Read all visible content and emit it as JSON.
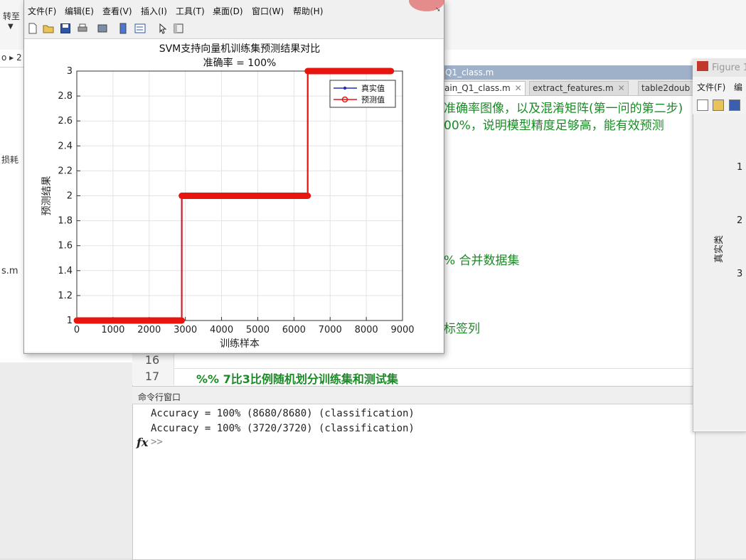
{
  "background": {
    "toolstrip_label": "转至",
    "address_text": "o ▸ 2",
    "left_snippets": [
      "损耗",
      "s.m"
    ],
    "editor": {
      "title": "Q1_class.m",
      "tabs": [
        {
          "label": "ain_Q1_class.m"
        },
        {
          "label": "extract_features.m"
        },
        {
          "label": "table2doub"
        }
      ],
      "code_lines": [
        "准确率图像，以及混淆矩阵(第一问的第二步)",
        "00%，说明模型精度足够高，能有效预测",
        "% 合并数据集",
        "标签列"
      ],
      "line_numbers": [
        "16",
        "17"
      ],
      "line_17_text": "%% 7比3比例随机划分训练集和测试集"
    },
    "command_window": {
      "title": "命令行窗口",
      "lines": [
        "Accuracy = 100% (8680/8680) (classification)",
        "Accuracy = 100% (3720/3720) (classification)"
      ],
      "fx": "fx",
      "prompt": ">>"
    },
    "right_figure": {
      "title": "Figure 1",
      "menu": [
        "文件(F)",
        "编"
      ],
      "ticks": [
        "1",
        "2",
        "3"
      ],
      "ylabel": "真实类"
    }
  },
  "figure": {
    "menu": [
      "文件(F)",
      "编辑(E)",
      "查看(V)",
      "插入(I)",
      "工具(T)",
      "桌面(D)",
      "窗口(W)",
      "帮助(H)"
    ],
    "toolbar_icons": [
      "new-file-icon",
      "open-folder-icon",
      "save-icon",
      "print-icon",
      "print-preview-icon",
      "colorbar-icon",
      "legend-icon",
      "pointer-icon",
      "property-editor-icon"
    ]
  },
  "chart_data": {
    "type": "line",
    "title": "SVM支持向量机训练集预测结果对比",
    "subtitle": "准确率 = 100%",
    "xlabel": "训练样本",
    "ylabel": "预测结果",
    "xlim": [
      0,
      9000
    ],
    "ylim": [
      1,
      3
    ],
    "xticks": [
      "0",
      "1000",
      "2000",
      "3000",
      "4000",
      "5000",
      "6000",
      "7000",
      "8000",
      "9000"
    ],
    "yticks": [
      "1",
      "1.2",
      "1.4",
      "1.6",
      "1.8",
      "2",
      "2.2",
      "2.4",
      "2.6",
      "2.8",
      "3"
    ],
    "grid": true,
    "legend_position": "top-right",
    "series": [
      {
        "name": "真实值",
        "color": "#1f2fbf",
        "marker": "*",
        "segments": [
          {
            "x_start": 1,
            "x_end": 2900,
            "y": 1
          },
          {
            "x_start": 2901,
            "x_end": 6380,
            "y": 2
          },
          {
            "x_start": 6381,
            "x_end": 8680,
            "y": 3
          }
        ]
      },
      {
        "name": "预测值",
        "color": "#e8150f",
        "marker": "o",
        "segments": [
          {
            "x_start": 1,
            "x_end": 2900,
            "y": 1
          },
          {
            "x_start": 2901,
            "x_end": 6380,
            "y": 2
          },
          {
            "x_start": 6381,
            "x_end": 8680,
            "y": 3
          }
        ]
      }
    ]
  }
}
